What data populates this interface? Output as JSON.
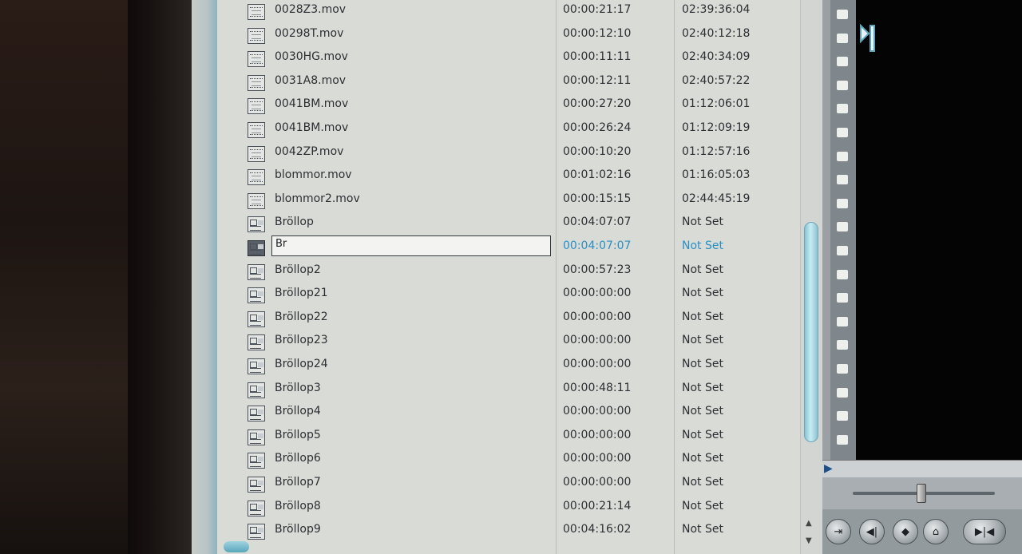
{
  "browser": {
    "rows": [
      {
        "name": "0028Z3.mov",
        "duration": "00:00:21:17",
        "timecode": "02:39:36:04",
        "type": "clip"
      },
      {
        "name": "00298T.mov",
        "duration": "00:00:12:10",
        "timecode": "02:40:12:18",
        "type": "clip"
      },
      {
        "name": "0030HG.mov",
        "duration": "00:00:11:11",
        "timecode": "02:40:34:09",
        "type": "clip"
      },
      {
        "name": "0031A8.mov",
        "duration": "00:00:12:11",
        "timecode": "02:40:57:22",
        "type": "clip"
      },
      {
        "name": "0041BM.mov",
        "duration": "00:00:27:20",
        "timecode": "01:12:06:01",
        "type": "clip"
      },
      {
        "name": "0041BM.mov",
        "duration": "00:00:26:24",
        "timecode": "01:12:09:19",
        "type": "clip"
      },
      {
        "name": "0042ZP.mov",
        "duration": "00:00:10:20",
        "timecode": "01:12:57:16",
        "type": "clip"
      },
      {
        "name": "blommor.mov",
        "duration": "00:01:02:16",
        "timecode": "01:16:05:03",
        "type": "clip"
      },
      {
        "name": "blommor2.mov",
        "duration": "00:00:15:15",
        "timecode": "02:44:45:19",
        "type": "clip"
      },
      {
        "name": "Bröllop",
        "duration": "00:04:07:07",
        "timecode": "Not Set",
        "type": "sequence"
      },
      {
        "name": "Br",
        "duration": "00:04:07:07",
        "timecode": "Not Set",
        "type": "sequence",
        "editing": true
      },
      {
        "name": "Bröllop2",
        "duration": "00:00:57:23",
        "timecode": "Not Set",
        "type": "sequence"
      },
      {
        "name": "Bröllop21",
        "duration": "00:00:00:00",
        "timecode": "Not Set",
        "type": "sequence"
      },
      {
        "name": "Bröllop22",
        "duration": "00:00:00:00",
        "timecode": "Not Set",
        "type": "sequence"
      },
      {
        "name": "Bröllop23",
        "duration": "00:00:00:00",
        "timecode": "Not Set",
        "type": "sequence"
      },
      {
        "name": "Bröllop24",
        "duration": "00:00:00:00",
        "timecode": "Not Set",
        "type": "sequence"
      },
      {
        "name": "Bröllop3",
        "duration": "00:00:48:11",
        "timecode": "Not Set",
        "type": "sequence"
      },
      {
        "name": "Bröllop4",
        "duration": "00:00:00:00",
        "timecode": "Not Set",
        "type": "sequence"
      },
      {
        "name": "Bröllop5",
        "duration": "00:00:00:00",
        "timecode": "Not Set",
        "type": "sequence"
      },
      {
        "name": "Bröllop6",
        "duration": "00:00:00:00",
        "timecode": "Not Set",
        "type": "sequence"
      },
      {
        "name": "Bröllop7",
        "duration": "00:00:00:00",
        "timecode": "Not Set",
        "type": "sequence"
      },
      {
        "name": "Bröllop8",
        "duration": "00:00:21:14",
        "timecode": "Not Set",
        "type": "sequence"
      },
      {
        "name": "Bröllop9",
        "duration": "00:04:16:02",
        "timecode": "Not Set",
        "type": "sequence"
      }
    ],
    "scroll": {
      "up_arrow": "▲",
      "down_arrow": "▼"
    }
  },
  "viewer": {
    "in_point_icon": "in-point-marker-icon",
    "playhead_glyph": "▶",
    "controls": [
      {
        "name": "mark-clip-button",
        "glyph": "⇥"
      },
      {
        "name": "mark-in-button",
        "glyph": "◀|"
      },
      {
        "name": "add-marker-button",
        "glyph": "◆"
      },
      {
        "name": "match-frame-button",
        "glyph": "⌂"
      },
      {
        "name": "mark-in-out-button",
        "glyph": "▶|◀"
      }
    ]
  },
  "colors": {
    "selected_text": "#2a8fc4",
    "scroll_thumb": "#9fd3e0"
  }
}
